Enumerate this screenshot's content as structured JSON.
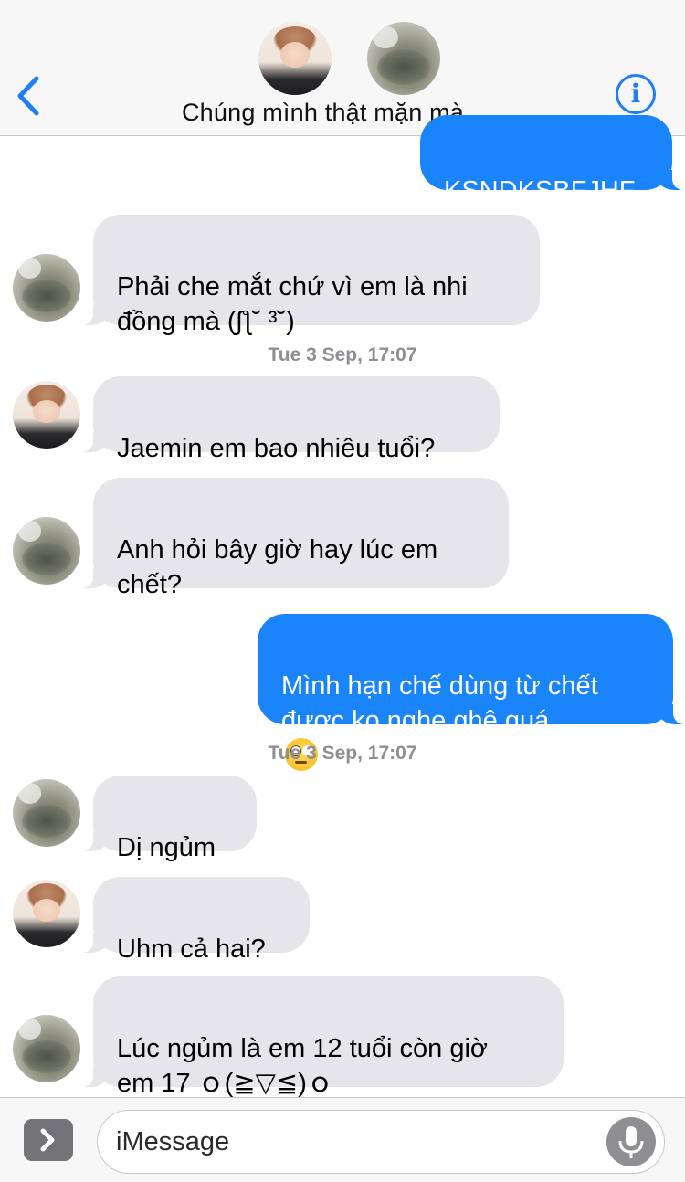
{
  "header": {
    "title": "Chúng mình thật mặn mà",
    "info_glyph": "i",
    "avatars": [
      "person-avatar",
      "cat-avatar"
    ]
  },
  "messages": [
    {
      "direction": "outgoing",
      "text": "KSNDKSBFJHF"
    },
    {
      "direction": "incoming",
      "avatar": "cat",
      "text": "Phải che mắt chứ vì em là nhi\nđồng mà (ʃƪ˘ ³˘)"
    },
    {
      "type": "timestamp",
      "text": "Tue 3 Sep, 17:07"
    },
    {
      "direction": "incoming",
      "avatar": "person",
      "text": "Jaemin em bao nhiêu tuổi?"
    },
    {
      "direction": "incoming",
      "avatar": "cat",
      "text": "Anh hỏi bây giờ hay lúc em\nchết?"
    },
    {
      "direction": "outgoing",
      "text": "Mình hạn chế dùng từ chết\nđược ko nghe ghê quá",
      "emoji": "face-with-rolling-eyes"
    },
    {
      "type": "timestamp",
      "text": "Tue 3 Sep, 17:07"
    },
    {
      "direction": "incoming",
      "avatar": "cat",
      "text": "Dị ngủm"
    },
    {
      "direction": "incoming",
      "avatar": "person",
      "text": "Uhm cả hai?"
    },
    {
      "direction": "incoming",
      "avatar": "cat",
      "text": "Lúc ngủm là em 12 tuổi còn giờ\nem 17 ｏ(≧▽≦)ｏ"
    }
  ],
  "composer": {
    "placeholder": "iMessage"
  },
  "colors": {
    "accent": "#1a84fb",
    "incoming_bubble": "#e5e5ea",
    "timestamp": "#8e8e93"
  }
}
